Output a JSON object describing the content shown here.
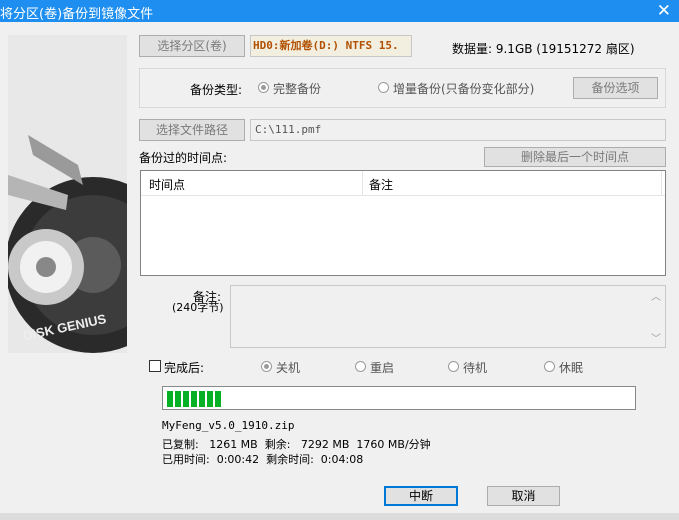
{
  "window": {
    "title": "将分区(卷)备份到镜像文件",
    "close_glyph": "✕"
  },
  "logo": {
    "text": "DISK GENIUS"
  },
  "source": {
    "select_button": "选择分区(卷)",
    "partition": "HD0:新加卷(D:) NTFS 15.",
    "data_size": "数据量: 9.1GB (19151272 扇区)"
  },
  "backup_type": {
    "label": "备份类型:",
    "full": "完整备份",
    "incremental": "增量备份(只备份变化部分)",
    "options_button": "备份选项"
  },
  "file": {
    "select_button": "选择文件路径",
    "path": "C:\\111.pmf"
  },
  "timepoints": {
    "label": "备份过的时间点:",
    "delete_button": "删除最后一个时间点",
    "columns": [
      "时间点",
      "备注"
    ]
  },
  "notes": {
    "label": "备注:",
    "sub": "(240字节)",
    "scroll_up": "︿",
    "scroll_down": "﹀"
  },
  "after": {
    "label": "完成后:",
    "options": [
      "关机",
      "重启",
      "待机",
      "休眠"
    ]
  },
  "progress": {
    "fraction": 0.13
  },
  "status": {
    "file": "MyFeng_v5.0_1910.zip",
    "line1": "已复制:   1261 MB  剩余:   7292 MB  1760 MB/分钟",
    "line2": "已用时间:  0:00:42  剩余时间:  0:04:08"
  },
  "buttons": {
    "stop": "中断",
    "cancel": "取消"
  }
}
